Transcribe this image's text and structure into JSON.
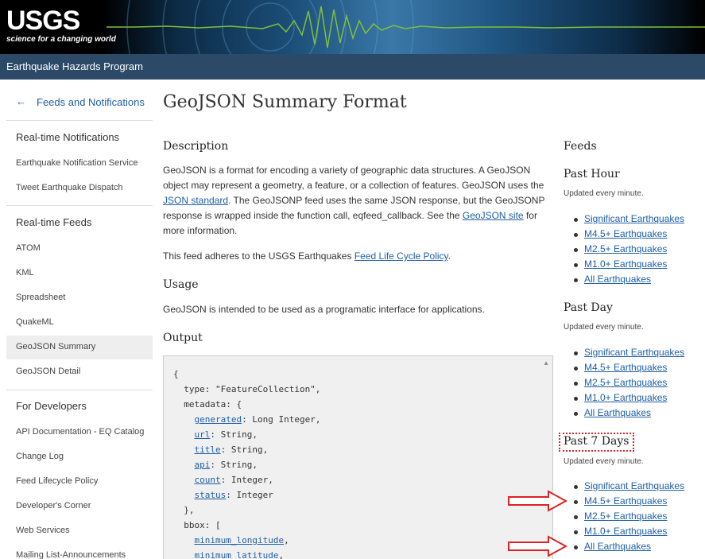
{
  "header": {
    "logo_text": "USGS",
    "logo_tagline": "science for a changing world",
    "program": "Earthquake Hazards Program"
  },
  "sidebar": {
    "back_link": "Feeds and Notifications",
    "sections": [
      {
        "title": "Real-time Notifications",
        "items": [
          "Earthquake Notification Service",
          "Tweet Earthquake Dispatch"
        ]
      },
      {
        "title": "Real-time Feeds",
        "items": [
          "ATOM",
          "KML",
          "Spreadsheet",
          "QuakeML",
          "GeoJSON Summary",
          "GeoJSON Detail"
        ]
      },
      {
        "title": "For Developers",
        "items": [
          "API Documentation - EQ Catalog",
          "Change Log",
          "Feed Lifecycle Policy",
          "Developer's Corner",
          "Web Services",
          "Mailing List-Announcements"
        ]
      }
    ],
    "active_item": "GeoJSON Summary"
  },
  "main": {
    "title": "GeoJSON Summary Format",
    "description_heading": "Description",
    "description": {
      "t1": "GeoJSON is a format for encoding a variety of geographic data structures. A GeoJSON object may represent a geometry, a feature, or a collection of features. GeoJSON uses the ",
      "l1": "JSON standard",
      "t2": ". The GeoJSONP feed uses the same JSON response, but the GeoJSONP response is wrapped inside the function call, eqfeed_callback. See the ",
      "l2": "GeoJSON site",
      "t3": " for more information."
    },
    "policy": {
      "t1": "This feed adheres to the USGS Earthquakes ",
      "l1": "Feed Life Cycle Policy",
      "t2": "."
    },
    "usage_heading": "Usage",
    "usage_text": "GeoJSON is intended to be used as a programatic interface for applications.",
    "output_heading": "Output",
    "code": {
      "l1": "{",
      "l2": "  type: \"FeatureCollection\",",
      "l3": "  metadata: {",
      "l4k": "generated",
      "l4v": ": Long Integer,",
      "l5k": "url",
      "l5v": ": String,",
      "l6k": "title",
      "l6v": ": String,",
      "l7k": "api",
      "l7v": ": String,",
      "l8k": "count",
      "l8v": ": Integer,",
      "l9k": "status",
      "l9v": ": Integer",
      "l10": "  },",
      "l11": "  bbox: [",
      "l12k": "minimum_longitude",
      "l12v": ",",
      "l13k": "minimum_latitude",
      "l13v": ","
    }
  },
  "feeds": {
    "heading": "Feeds",
    "groups": [
      {
        "title": "Past Hour",
        "note": "Updated every minute.",
        "links": [
          "Significant Earthquakes",
          "M4.5+ Earthquakes",
          "M2.5+ Earthquakes",
          "M1.0+ Earthquakes",
          "All Earthquakes"
        ]
      },
      {
        "title": "Past Day",
        "note": "Updated every minute.",
        "links": [
          "Significant Earthquakes",
          "M4.5+ Earthquakes",
          "M2.5+ Earthquakes",
          "M1.0+ Earthquakes",
          "All Earthquakes"
        ]
      },
      {
        "title": "Past 7 Days",
        "note": "Updated every minute.",
        "links": [
          "Significant Earthquakes",
          "M4.5+ Earthquakes",
          "M2.5+ Earthquakes",
          "M1.0+ Earthquakes",
          "All Earthquakes"
        ]
      }
    ]
  },
  "colors": {
    "link": "#1f5fa6",
    "program_bar": "#2c4a68",
    "annotation_red": "#dd2222"
  }
}
